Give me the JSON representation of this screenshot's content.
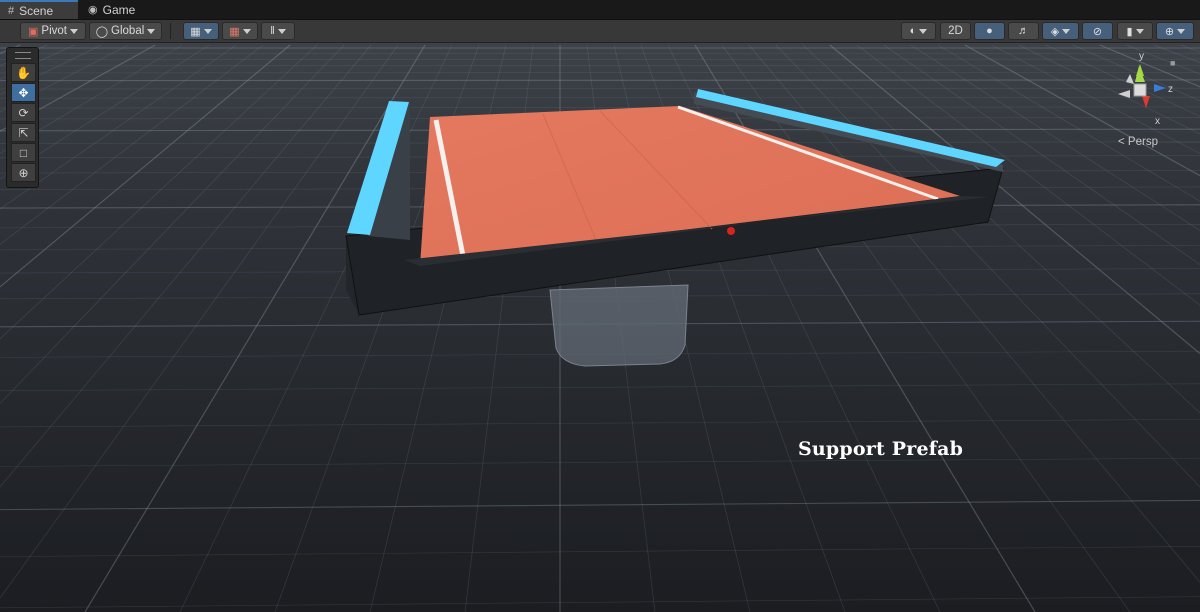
{
  "tabs": [
    {
      "label": "Scene",
      "icon": "grid-icon",
      "active": true
    },
    {
      "label": "Game",
      "icon": "gamepad-icon",
      "active": false
    }
  ],
  "toolbar": {
    "pivot_label": "Pivot",
    "global_label": "Global",
    "twod_label": "2D"
  },
  "tools": [
    {
      "name": "hand-tool",
      "icon": "hand-icon"
    },
    {
      "name": "move-tool",
      "icon": "move-icon",
      "active": true
    },
    {
      "name": "rotate-tool",
      "icon": "rotate-icon"
    },
    {
      "name": "scale-tool",
      "icon": "scale-icon"
    },
    {
      "name": "rect-tool",
      "icon": "rect-icon"
    },
    {
      "name": "transform-tool",
      "icon": "transform-icon"
    }
  ],
  "gizmo": {
    "y_label": "y",
    "z_label": "z",
    "x_label": "x",
    "projection_label": "Persp"
  },
  "caption": "Support Prefab",
  "colors": {
    "court": "#e2765c",
    "rail_glow": "#5fd6ff",
    "axis_x": "#e03a2e",
    "axis_y": "#9fd63b",
    "axis_z": "#3d7bd8",
    "accent_tab": "#3a79bb"
  }
}
